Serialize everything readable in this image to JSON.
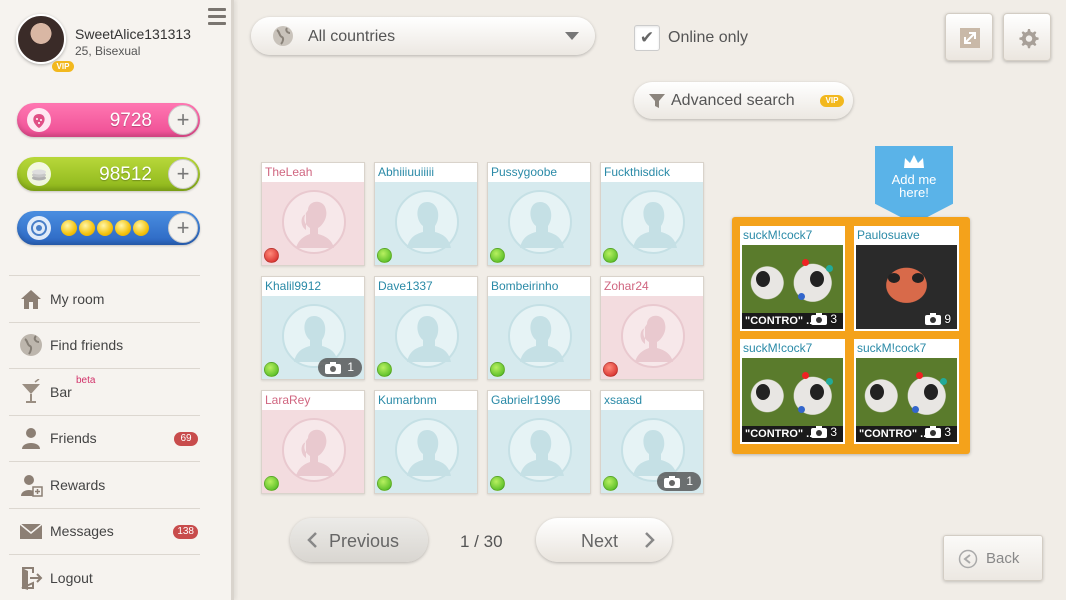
{
  "profile": {
    "name": "SweetAlice131313",
    "info": "25, Bisexual",
    "vip_badge": "VIP"
  },
  "currency": {
    "strawberries": "9728",
    "coins": "98512",
    "coin_rating": 5
  },
  "nav": [
    {
      "label": "My room",
      "icon": "house-icon"
    },
    {
      "label": "Find friends",
      "icon": "globe-icon"
    },
    {
      "label": "Bar",
      "icon": "cocktail-icon",
      "tag": "beta"
    },
    {
      "label": "Friends",
      "icon": "person-icon",
      "badge": "69"
    },
    {
      "label": "Rewards",
      "icon": "reward-icon"
    },
    {
      "label": "Messages",
      "icon": "envelope-icon",
      "badge": "138"
    },
    {
      "label": "Logout",
      "icon": "logout-icon"
    }
  ],
  "filters": {
    "country": "All countries",
    "online_only_label": "Online only",
    "online_only_checked": true,
    "advanced_label": "Advanced search",
    "advanced_vip": "VIP"
  },
  "users": [
    {
      "name": "TheLeah",
      "gender": "female",
      "online": false
    },
    {
      "name": "Abhiiiuuiiiii",
      "gender": "male",
      "online": true
    },
    {
      "name": "Pussygoobe",
      "gender": "male",
      "online": true
    },
    {
      "name": "Fuckthisdick",
      "gender": "male",
      "online": true
    },
    {
      "name": "Khalil9912",
      "gender": "male",
      "online": true,
      "photos": "1"
    },
    {
      "name": "Dave1337",
      "gender": "male",
      "online": true
    },
    {
      "name": "Bombeirinho",
      "gender": "male",
      "online": true
    },
    {
      "name": "Zohar24",
      "gender": "female",
      "online": false
    },
    {
      "name": "LaraRey",
      "gender": "female",
      "online": true
    },
    {
      "name": "Kumarbnm",
      "gender": "male",
      "online": true
    },
    {
      "name": "Gabrielr1996",
      "gender": "male",
      "online": true
    },
    {
      "name": "xsaasd",
      "gender": "male",
      "online": true,
      "photos": "1"
    }
  ],
  "add_me": {
    "line1": "Add me",
    "line2": "here!"
  },
  "featured": [
    {
      "name": "suckM!cock7",
      "photos": "3",
      "caption": "\"CONTRO\" ..."
    },
    {
      "name": "Paulosuave",
      "photos": "9"
    },
    {
      "name": "suckM!cock7",
      "photos": "3",
      "caption": "\"CONTRO\" ..."
    },
    {
      "name": "suckM!cock7",
      "photos": "3",
      "caption": "\"CONTRO\" ..."
    }
  ],
  "pagination": {
    "previous": "Previous",
    "indicator": "1 / 30",
    "next": "Next"
  },
  "back_label": "Back"
}
